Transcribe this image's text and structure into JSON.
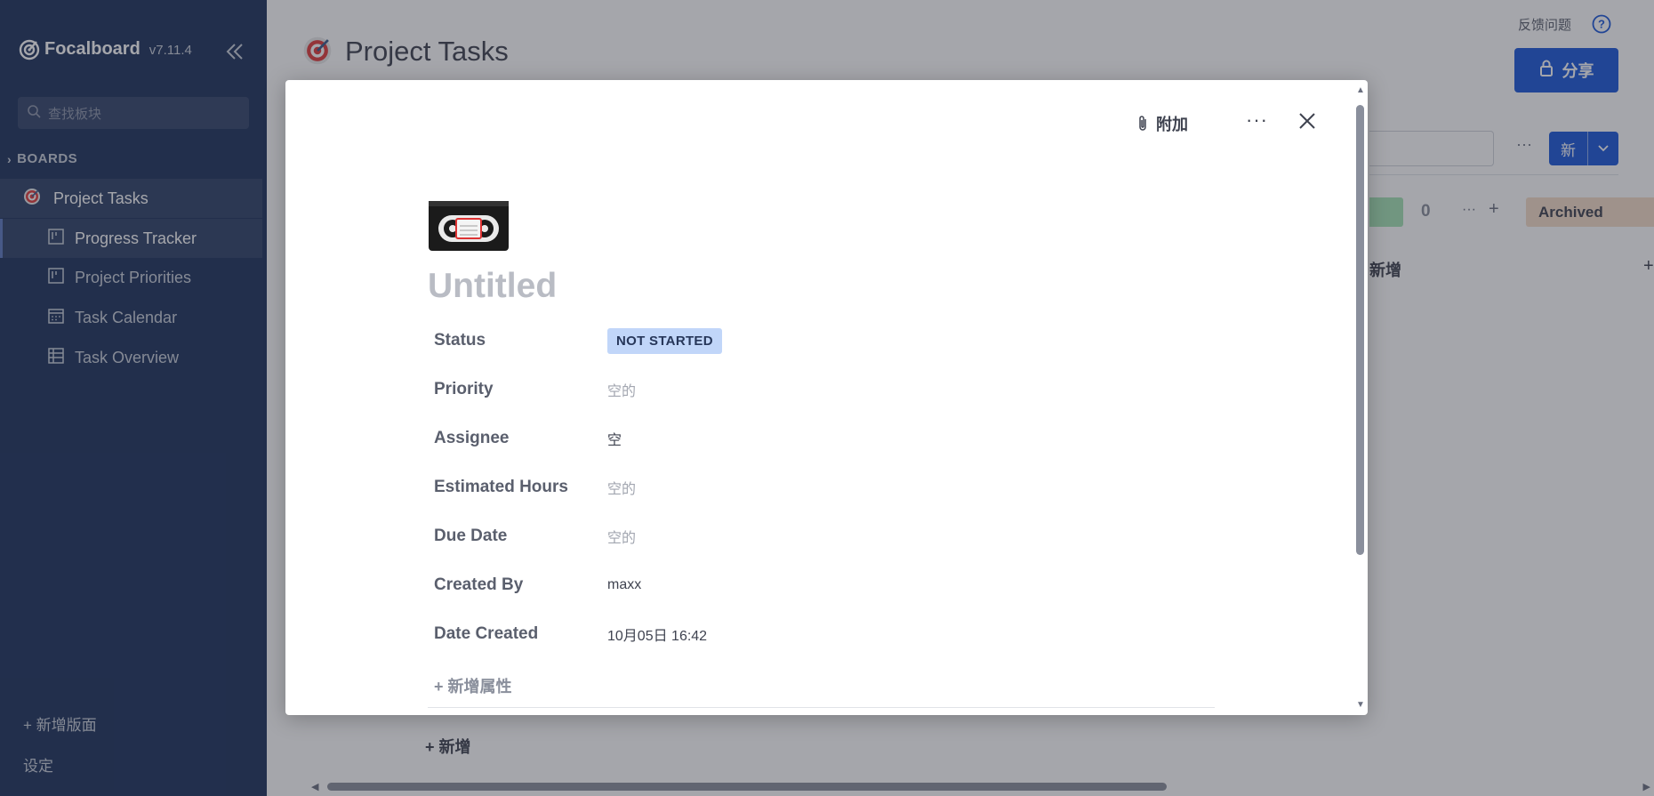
{
  "sidebar": {
    "brand": "Focalboard",
    "version": "v7.11.4",
    "search_placeholder": "查找板块",
    "section_label": "BOARDS",
    "board": {
      "label": "Project Tasks",
      "icon": "target-icon"
    },
    "views": [
      {
        "label": "Progress Tracker",
        "icon": "board-view-icon",
        "active": true
      },
      {
        "label": "Project Priorities",
        "icon": "board-view-icon",
        "active": false
      },
      {
        "label": "Task Calendar",
        "icon": "calendar-view-icon",
        "active": false
      },
      {
        "label": "Task Overview",
        "icon": "table-view-icon",
        "active": false
      }
    ],
    "add_board": "+ 新增版面",
    "settings": "设定"
  },
  "main": {
    "title": "Project Tasks",
    "feedback": "反馈问题",
    "share_label": "分享",
    "more": "···",
    "new_label": "新",
    "column_count": "0",
    "column_dots": "···",
    "column_plus": "+",
    "archived_label": "Archived",
    "column_add": "新增",
    "far_plus": "+",
    "bottom_add": "+ 新增"
  },
  "dialog": {
    "attach_label": "附加",
    "more": "···",
    "card_title": "Untitled",
    "card_icon": "vhs-cassette-icon",
    "properties": [
      {
        "name": "Status",
        "value": "NOT STARTED",
        "type": "badge"
      },
      {
        "name": "Priority",
        "value": "空的",
        "type": "empty"
      },
      {
        "name": "Assignee",
        "value": "空",
        "type": "text"
      },
      {
        "name": "Estimated Hours",
        "value": "空的",
        "type": "empty"
      },
      {
        "name": "Due Date",
        "value": "空的",
        "type": "empty"
      },
      {
        "name": "Created By",
        "value": "maxx",
        "type": "text"
      },
      {
        "name": "Date Created",
        "value": "10月05日 16:42",
        "type": "text"
      }
    ],
    "add_property": "+ 新增属性"
  },
  "colors": {
    "sidebar_bg": "#1e325c",
    "accent": "#1c58d9",
    "status_badge_bg": "#c1d6f9",
    "archived_bg": "#f5ddc8",
    "green_chip": "#a6e3b6"
  }
}
